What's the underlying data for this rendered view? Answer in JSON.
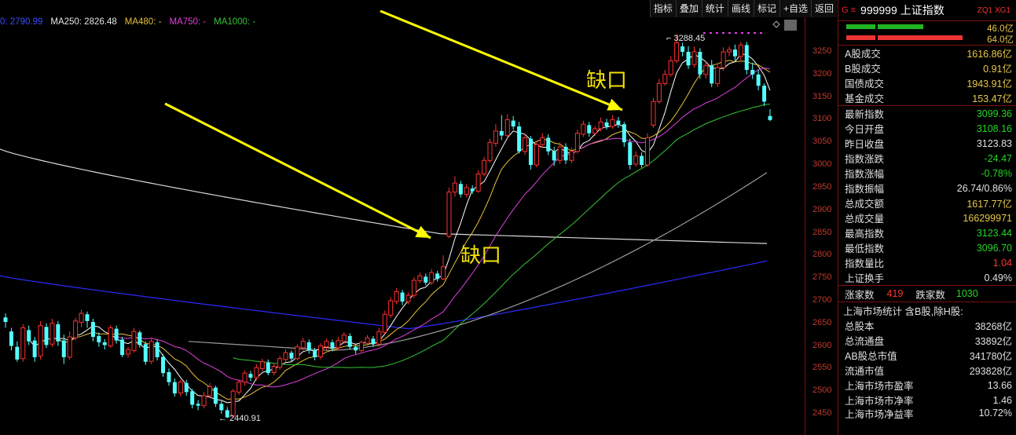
{
  "toolbar": [
    "指标",
    "叠加",
    "统计",
    "画线",
    "标记",
    "+自选",
    "返回"
  ],
  "ma_legend": [
    {
      "label": "0: 2790.99",
      "color": "#3d4dff"
    },
    {
      "label": "MA250: 2826.48",
      "color": "#e6e6e6"
    },
    {
      "label": "MA480: -",
      "color": "#e8c13a"
    },
    {
      "label": "MA750: -",
      "color": "#e040e0"
    },
    {
      "label": "MA1000: -",
      "color": "#35c435"
    }
  ],
  "chart_data": {
    "type": "candlestick",
    "y_ticks": [
      3250,
      3200,
      3150,
      3100,
      3050,
      3000,
      2950,
      2900,
      2850,
      2800,
      2750,
      2700,
      2650,
      2600,
      2550,
      2500,
      2450
    ],
    "ylim": [
      2420,
      3290
    ],
    "high_label": "3288.45",
    "low_label": "2440.91",
    "annotations": [
      "缺口",
      "缺口"
    ],
    "candles": [
      [
        2663,
        2653,
        2672,
        2640
      ],
      [
        2632,
        2600,
        2640,
        2590
      ],
      [
        2598,
        2570,
        2610,
        2565
      ],
      [
        2572,
        2640,
        2648,
        2565
      ],
      [
        2635,
        2610,
        2645,
        2602
      ],
      [
        2612,
        2575,
        2620,
        2565
      ],
      [
        2578,
        2645,
        2655,
        2570
      ],
      [
        2642,
        2602,
        2650,
        2595
      ],
      [
        2604,
        2650,
        2660,
        2598
      ],
      [
        2648,
        2610,
        2655,
        2600
      ],
      [
        2612,
        2575,
        2625,
        2560
      ],
      [
        2575,
        2620,
        2632,
        2570
      ],
      [
        2618,
        2655,
        2662,
        2612
      ],
      [
        2652,
        2672,
        2680,
        2642
      ],
      [
        2670,
        2655,
        2676,
        2640
      ],
      [
        2653,
        2620,
        2660,
        2610
      ],
      [
        2622,
        2608,
        2630,
        2598
      ],
      [
        2608,
        2602,
        2615,
        2592
      ],
      [
        2600,
        2640,
        2646,
        2596
      ],
      [
        2638,
        2612,
        2645,
        2605
      ],
      [
        2614,
        2580,
        2620,
        2575
      ],
      [
        2582,
        2592,
        2598,
        2574
      ],
      [
        2590,
        2632,
        2640,
        2585
      ],
      [
        2630,
        2602,
        2634,
        2596
      ],
      [
        2604,
        2565,
        2610,
        2558
      ],
      [
        2566,
        2610,
        2618,
        2560
      ],
      [
        2608,
        2575,
        2614,
        2568
      ],
      [
        2576,
        2540,
        2582,
        2532
      ],
      [
        2542,
        2520,
        2550,
        2512
      ],
      [
        2520,
        2495,
        2528,
        2488
      ],
      [
        2496,
        2520,
        2525,
        2488
      ],
      [
        2518,
        2498,
        2525,
        2490
      ],
      [
        2500,
        2470,
        2505,
        2462
      ],
      [
        2472,
        2468,
        2480,
        2458
      ],
      [
        2468,
        2490,
        2498,
        2462
      ],
      [
        2490,
        2510,
        2518,
        2484
      ],
      [
        2508,
        2472,
        2512,
        2465
      ],
      [
        2472,
        2458,
        2478,
        2450
      ],
      [
        2458,
        2442,
        2465,
        2440.91
      ],
      [
        2445,
        2500,
        2505,
        2442
      ],
      [
        2498,
        2520,
        2526,
        2492
      ],
      [
        2520,
        2540,
        2546,
        2512
      ],
      [
        2538,
        2530,
        2545,
        2522
      ],
      [
        2530,
        2552,
        2560,
        2524
      ],
      [
        2550,
        2565,
        2572,
        2544
      ],
      [
        2563,
        2540,
        2570,
        2535
      ],
      [
        2541,
        2555,
        2562,
        2535
      ],
      [
        2553,
        2572,
        2578,
        2548
      ],
      [
        2570,
        2585,
        2592,
        2564
      ],
      [
        2585,
        2572,
        2590,
        2566
      ],
      [
        2572,
        2598,
        2604,
        2568
      ],
      [
        2596,
        2610,
        2618,
        2590
      ],
      [
        2608,
        2590,
        2614,
        2583
      ],
      [
        2590,
        2575,
        2596,
        2568
      ],
      [
        2576,
        2600,
        2606,
        2570
      ],
      [
        2598,
        2610,
        2616,
        2592
      ],
      [
        2608,
        2596,
        2614,
        2588
      ],
      [
        2596,
        2612,
        2620,
        2590
      ],
      [
        2610,
        2624,
        2630,
        2604
      ],
      [
        2622,
        2598,
        2628,
        2592
      ],
      [
        2598,
        2590,
        2604,
        2582
      ],
      [
        2590,
        2608,
        2612,
        2584
      ],
      [
        2606,
        2618,
        2624,
        2600
      ],
      [
        2616,
        2604,
        2622,
        2598
      ],
      [
        2604,
        2632,
        2640,
        2598
      ],
      [
        2630,
        2670,
        2678,
        2626
      ],
      [
        2668,
        2700,
        2708,
        2662
      ],
      [
        2698,
        2720,
        2728,
        2692
      ],
      [
        2718,
        2698,
        2724,
        2690
      ],
      [
        2698,
        2712,
        2718,
        2692
      ],
      [
        2712,
        2745,
        2752,
        2706
      ],
      [
        2744,
        2755,
        2762,
        2738
      ],
      [
        2753,
        2740,
        2760,
        2734
      ],
      [
        2740,
        2762,
        2770,
        2735
      ],
      [
        2760,
        2748,
        2766,
        2742
      ],
      [
        2748,
        2775,
        2800,
        2745
      ],
      [
        2842,
        2940,
        2950,
        2838
      ],
      [
        2940,
        2960,
        2975,
        2930
      ],
      [
        2958,
        2935,
        2965,
        2928
      ],
      [
        2935,
        2950,
        2958,
        2928
      ],
      [
        2948,
        2942,
        2955,
        2936
      ],
      [
        2942,
        2980,
        2988,
        2938
      ],
      [
        2980,
        3010,
        3018,
        2975
      ],
      [
        3010,
        3050,
        3058,
        3005
      ],
      [
        3048,
        3075,
        3090,
        3040
      ],
      [
        3075,
        3065,
        3110,
        3055
      ],
      [
        3065,
        3100,
        3112,
        3058
      ],
      [
        3098,
        3085,
        3108,
        3078
      ],
      [
        3085,
        3030,
        3095,
        3025
      ],
      [
        3030,
        3060,
        3068,
        3022
      ],
      [
        3058,
        3000,
        3064,
        2990
      ],
      [
        3000,
        3045,
        3052,
        2995
      ],
      [
        3045,
        3060,
        3070,
        3038
      ],
      [
        3060,
        3030,
        3068,
        3022
      ],
      [
        3030,
        3010,
        3040,
        2998
      ],
      [
        3010,
        3040,
        3050,
        3002
      ],
      [
        3040,
        3010,
        3048,
        3002
      ],
      [
        3010,
        3030,
        3038,
        3004
      ],
      [
        3030,
        3070,
        3078,
        3025
      ],
      [
        3068,
        3090,
        3098,
        3062
      ],
      [
        3088,
        3070,
        3095,
        3062
      ],
      [
        3070,
        3080,
        3086,
        3064
      ],
      [
        3080,
        3095,
        3105,
        3074
      ],
      [
        3094,
        3085,
        3102,
        3078
      ],
      [
        3085,
        3100,
        3110,
        3080
      ],
      [
        3098,
        3090,
        3106,
        3082
      ],
      [
        3090,
        3050,
        3095,
        3040
      ],
      [
        3050,
        3000,
        3058,
        2990
      ],
      [
        3002,
        3020,
        3030,
        2996
      ],
      [
        3020,
        3000,
        3028,
        2994
      ],
      [
        3000,
        3060,
        3070,
        2996
      ],
      [
        3088,
        3140,
        3148,
        3082
      ],
      [
        3140,
        3180,
        3190,
        3135
      ],
      [
        3180,
        3200,
        3210,
        3175
      ],
      [
        3200,
        3230,
        3240,
        3195
      ],
      [
        3230,
        3270,
        3288.45,
        3225
      ],
      [
        3262,
        3250,
        3270,
        3240
      ],
      [
        3250,
        3220,
        3262,
        3212
      ],
      [
        3222,
        3250,
        3262,
        3215
      ],
      [
        3250,
        3200,
        3258,
        3190
      ],
      [
        3200,
        3220,
        3230,
        3190
      ],
      [
        3220,
        3180,
        3232,
        3172
      ],
      [
        3180,
        3215,
        3225,
        3172
      ],
      [
        3215,
        3250,
        3260,
        3208
      ],
      [
        3250,
        3255,
        3262,
        3240
      ],
      [
        3255,
        3240,
        3266,
        3230
      ],
      [
        3240,
        3265,
        3272,
        3232
      ],
      [
        3265,
        3210,
        3272,
        3200
      ],
      [
        3210,
        3200,
        3226,
        3190
      ],
      [
        3200,
        3175,
        3210,
        3165
      ],
      [
        3175,
        3140,
        3180,
        3130
      ],
      [
        3108.16,
        3099.36,
        3123.44,
        3096.7
      ]
    ]
  },
  "panel": {
    "code": "999999",
    "name": "上证指数",
    "tag": "ZQ1 XG1",
    "bar_values": [
      "46.0亿",
      "64.0亿"
    ],
    "rows1": [
      {
        "label": "A股成交",
        "value": "1616.86亿",
        "color": "#e8c84a"
      },
      {
        "label": "B股成交",
        "value": "0.91亿",
        "color": "#e8c84a"
      },
      {
        "label": "国债成交",
        "value": "1943.91亿",
        "color": "#e8c84a"
      },
      {
        "label": "基金成交",
        "value": "153.47亿",
        "color": "#e8c84a"
      }
    ],
    "rows2": [
      {
        "label": "最新指数",
        "value": "3099.36",
        "color": "#25d425"
      },
      {
        "label": "今日开盘",
        "value": "3108.16",
        "color": "#25d425"
      },
      {
        "label": "昨日收盘",
        "value": "3123.83",
        "color": "#e0e0e0"
      },
      {
        "label": "指数涨跌",
        "value": "-24.47",
        "color": "#25d425"
      },
      {
        "label": "指数涨幅",
        "value": "-0.78%",
        "color": "#25d425"
      },
      {
        "label": "指数振幅",
        "value": "26.74/0.86%",
        "color": "#e0e0e0"
      },
      {
        "label": "总成交额",
        "value": "1617.77亿",
        "color": "#e8c84a"
      },
      {
        "label": "总成交量",
        "value": "166299971",
        "color": "#e8c84a"
      },
      {
        "label": "最高指数",
        "value": "3123.44",
        "color": "#25d425"
      },
      {
        "label": "最低指数",
        "value": "3096.70",
        "color": "#25d425"
      },
      {
        "label": "指数量比",
        "value": "1.04",
        "color": "#ff3333"
      },
      {
        "label": "上证换手",
        "value": "0.49%",
        "color": "#e0e0e0"
      }
    ],
    "updown": {
      "up_label": "涨家数",
      "up_value": "419",
      "down_label": "跌家数",
      "down_value": "1030"
    },
    "market_title": "上海市场统计 含B股,除H股:",
    "rows3": [
      {
        "label": "总股本",
        "value": "38268亿",
        "color": "#e0e0e0"
      },
      {
        "label": "总流通盘",
        "value": "33892亿",
        "color": "#e0e0e0"
      },
      {
        "label": "AB股总市值",
        "value": "341780亿",
        "color": "#e0e0e0"
      },
      {
        "label": "流通市值",
        "value": "293828亿",
        "color": "#e0e0e0"
      },
      {
        "label": "上海市场市盈率",
        "value": "13.66",
        "color": "#e0e0e0"
      },
      {
        "label": "上海市场市净率",
        "value": "1.46",
        "color": "#e0e0e0"
      },
      {
        "label": "上海市场净益率",
        "value": "10.72%",
        "color": "#e0e0e0"
      }
    ]
  }
}
